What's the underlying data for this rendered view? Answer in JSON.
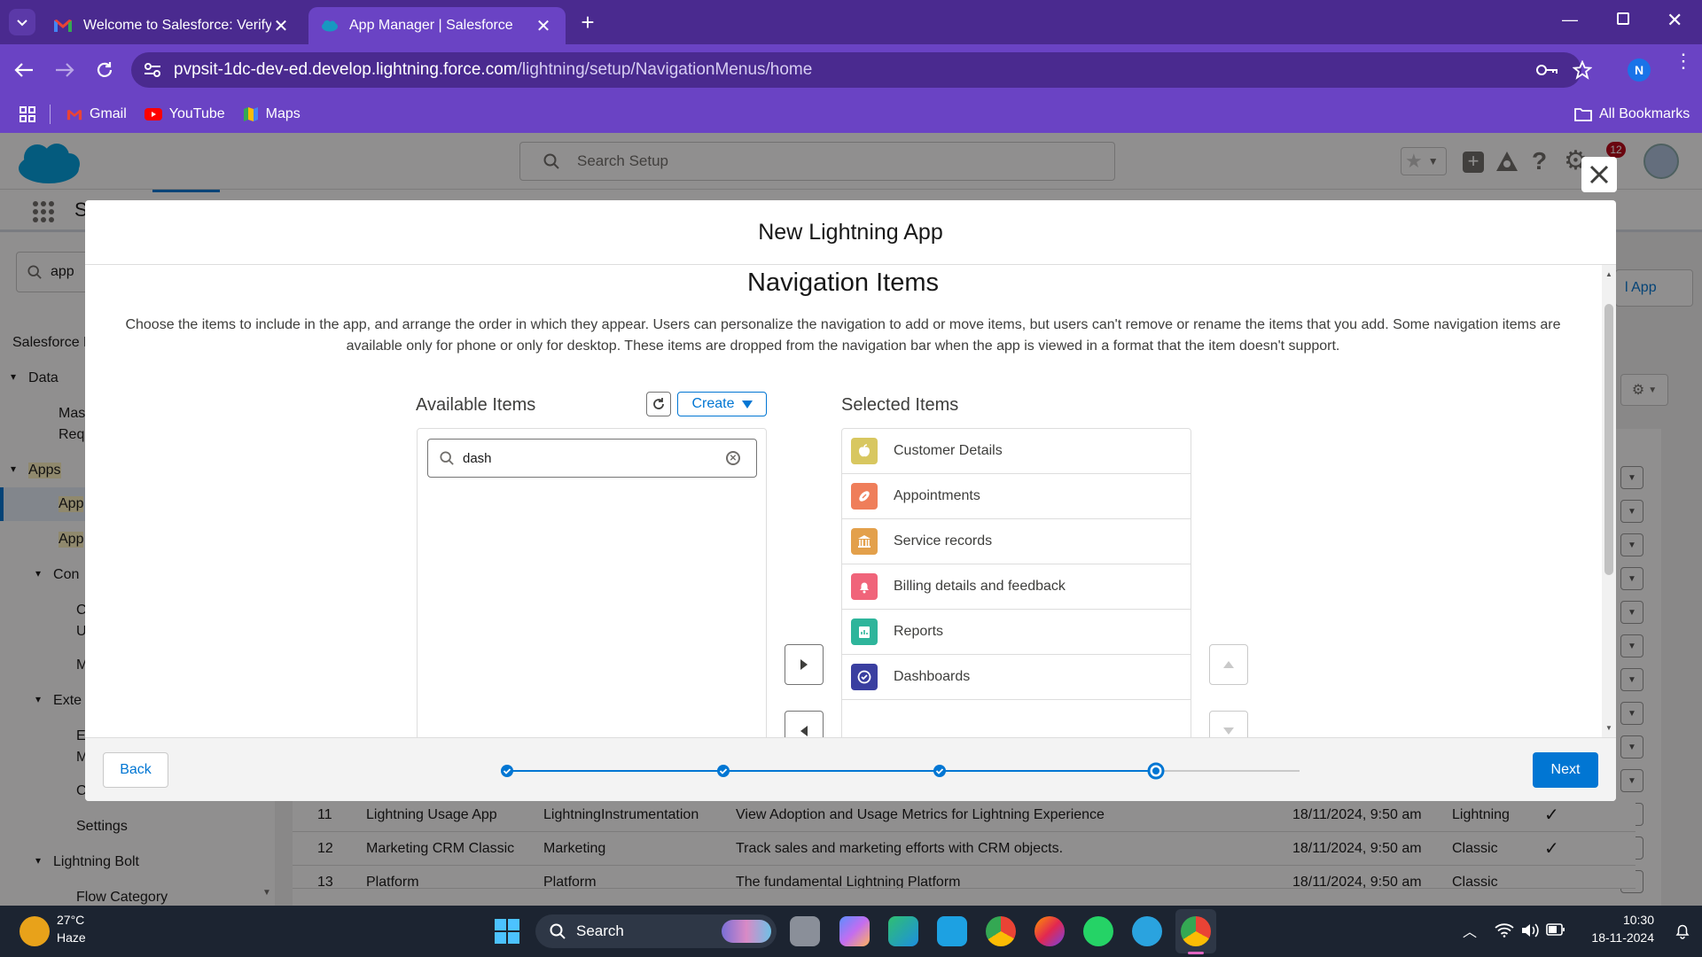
{
  "browser": {
    "tabs": [
      {
        "title": "Welcome to Salesforce: Verify y",
        "favicon": "gmail-icon"
      },
      {
        "title": "App Manager | Salesforce",
        "favicon": "salesforce-cloud-icon"
      }
    ],
    "url_host": "pvpsit-1dc-dev-ed.develop.lightning.force.com",
    "url_path": "/lightning/setup/NavigationMenus/home",
    "profile_initial": "N",
    "bookmarks": [
      {
        "label": "Gmail",
        "icon": "gmail-icon"
      },
      {
        "label": "YouTube",
        "icon": "youtube-icon"
      },
      {
        "label": "Maps",
        "icon": "maps-icon"
      }
    ],
    "all_bookmarks_label": "All Bookmarks",
    "colors": {
      "tabbar": "#4a2a8f",
      "toolbar": "#6a43c4"
    }
  },
  "salesforce": {
    "search_placeholder": "Search Setup",
    "notification_count": "12",
    "nav_letter": "S",
    "quickfind_value": "app",
    "sidebar": {
      "root": "Salesforce M",
      "data": "Data",
      "data_children": [
        "Mas",
        "Req"
      ],
      "apps": "Apps",
      "app_items": [
        "App",
        "App"
      ],
      "con": "Con",
      "con_children": [
        "C",
        "U",
        "M"
      ],
      "exte": "Exte",
      "exte_children": [
        "E",
        "M",
        "C"
      ],
      "settings": "Settings",
      "lightning_bolt": "Lightning Bolt",
      "flow_category": "Flow Category"
    },
    "new_app_button_fragment": "l App",
    "table_rows": [
      {
        "num": "11",
        "name": "Lightning Usage App",
        "dev": "LightningInstrumentation",
        "desc": "View Adoption and Usage Metrics for Lightning Experience",
        "modified": "18/11/2024, 9:50 am",
        "type": "Lightning",
        "visible": true
      },
      {
        "num": "12",
        "name": "Marketing CRM Classic",
        "dev": "Marketing",
        "desc": "Track sales and marketing efforts with CRM objects.",
        "modified": "18/11/2024, 9:50 am",
        "type": "Classic",
        "visible": true
      },
      {
        "num": "13",
        "name": "Platform",
        "dev": "Platform",
        "desc": "The fundamental Lightning Platform",
        "modified": "18/11/2024, 9:50 am",
        "type": "Classic",
        "visible": false
      }
    ]
  },
  "modal": {
    "title": "New Lightning App",
    "section_title": "Navigation Items",
    "description": "Choose the items to include in the app, and arrange the order in which they appear. Users can personalize the navigation to add or move items, but users can't remove or rename the items that you add. Some navigation items are available only for phone or only for desktop. These items are dropped from the navigation bar when the app is viewed in a format that the item doesn't support.",
    "available_label": "Available Items",
    "create_label": "Create",
    "search_value": "dash",
    "selected_label": "Selected Items",
    "selected_items": [
      {
        "label": "Customer Details",
        "icon": "apple-icon",
        "color": "#d8c760"
      },
      {
        "label": "Appointments",
        "icon": "football-icon",
        "color": "#ef7e5a"
      },
      {
        "label": "Service records",
        "icon": "bank-icon",
        "color": "#e3a04b"
      },
      {
        "label": "Billing details and feedback",
        "icon": "bell-icon",
        "color": "#f0647a"
      },
      {
        "label": "Reports",
        "icon": "report-icon",
        "color": "#2eb59b"
      },
      {
        "label": "Dashboards",
        "icon": "dashboard-icon",
        "color": "#3a3fa0"
      }
    ],
    "back_label": "Back",
    "next_label": "Next",
    "progress": {
      "total_steps": 5,
      "current_step": 4
    },
    "accent": "#0176d3"
  },
  "taskbar": {
    "weather_temp": "27°C",
    "weather_desc": "Haze",
    "search_label": "Search",
    "time": "10:30",
    "date": "18-11-2024"
  }
}
